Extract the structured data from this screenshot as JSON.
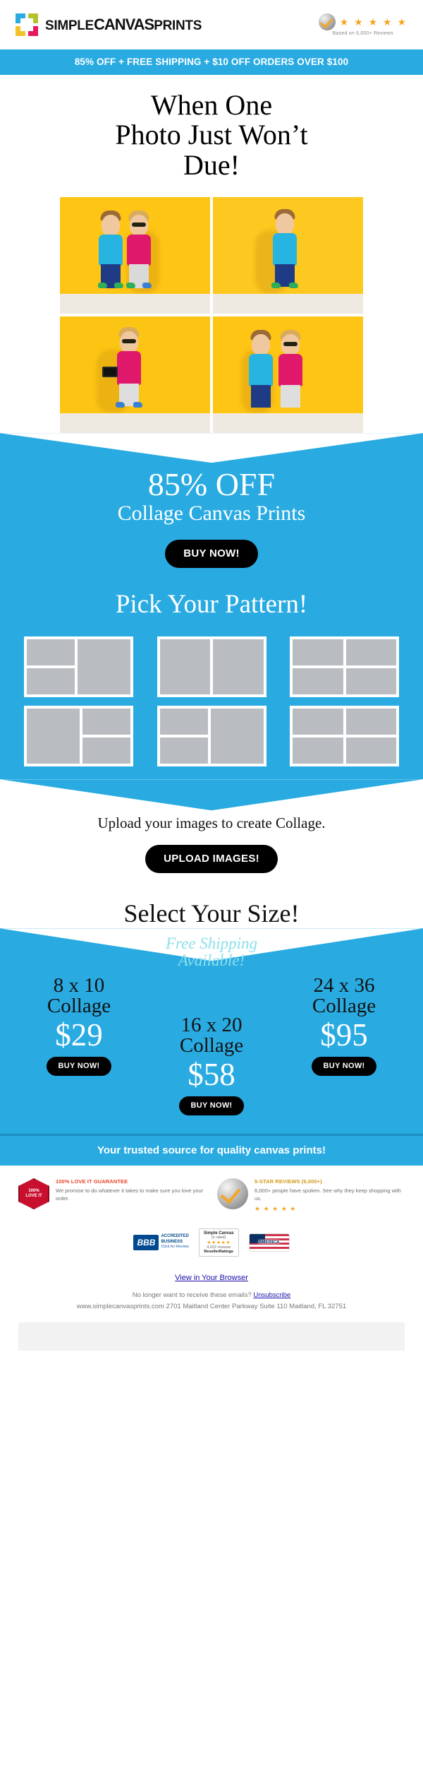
{
  "brand": {
    "name_part1": "SIMPLE",
    "name_part2": "CANVAS",
    "name_part3": "PRINTS",
    "logo_icon": "four-square-logo-icon",
    "colors": {
      "primary_blue": "#29abe2",
      "accent_yellow": "#fec515",
      "black": "#000000",
      "star_gold": "#f5a623"
    }
  },
  "header": {
    "review_badge": {
      "icon": "check-seal-icon",
      "stars": "★ ★ ★ ★ ★",
      "caption": "Based on 6,000+ Reviews"
    }
  },
  "promo_bar": {
    "text": "85% OFF + FREE SHIPPING + $10 OFF ORDERS OVER $100"
  },
  "hero": {
    "title_line1": "When One",
    "title_line2": "Photo Just Won’t",
    "title_line3": "Due!",
    "collage_alt": "four-photo-collage-of-kids"
  },
  "offer": {
    "headline": "85% OFF",
    "subhead": "Collage Canvas Prints",
    "cta": "BUY NOW!"
  },
  "pattern_section": {
    "title": "Pick Your Pattern!",
    "patterns": [
      {
        "name": "pattern-1-left-split-right-tall"
      },
      {
        "name": "pattern-2-two-tall-columns"
      },
      {
        "name": "pattern-3-quad-grid"
      },
      {
        "name": "pattern-4-left-tall-right-split"
      },
      {
        "name": "pattern-5-left-split-right-tall"
      },
      {
        "name": "pattern-6-quad-grid-wide"
      }
    ]
  },
  "upload_section": {
    "text": "Upload your images to create Collage.",
    "cta": "UPLOAD IMAGES!"
  },
  "size_section": {
    "title": "Select Your Size!",
    "free_shipping_line1": "Free Shipping",
    "free_shipping_line2": "Available!",
    "options": [
      {
        "size": "8 x 10",
        "product": "Collage",
        "price": "$29",
        "cta": "BUY NOW!"
      },
      {
        "size": "16 x 20",
        "product": "Collage",
        "price": "$58",
        "cta": "BUY NOW!"
      },
      {
        "size": "24 x 36",
        "product": "Collage",
        "price": "$95",
        "cta": "BUY NOW!"
      }
    ]
  },
  "trust_bar": {
    "text": "Your trusted source for quality canvas prints!"
  },
  "footer": {
    "guarantee": {
      "seal_icon": "love-it-guarantee-seal-icon",
      "seal_line1": "100%",
      "seal_line2": "LOVE IT",
      "title": "100% LOVE IT GUARANTEE",
      "body": "We promise to do whatever it takes to make sure you love your order."
    },
    "reviews": {
      "seal_icon": "check-seal-icon",
      "title": "5-STAR REVIEWS (6,000+)",
      "body": "6,000+ people have spoken. See why they keep shopping with us.",
      "stars": "★ ★ ★ ★ ★"
    },
    "badges": {
      "bbb_mark": "BBB",
      "bbb_line1": "ACCREDITED",
      "bbb_line2": "BUSINESS",
      "bbb_click": "Click for Review",
      "reseller_title": "Simple Canvas",
      "reseller_rated": "(x rated)",
      "reseller_stars": "★★★★★",
      "reseller_count": "4,022 reviews",
      "reseller_brand": "ResellerRatings",
      "america_label": "AMERICA"
    },
    "view_browser": "View in Your Browser",
    "unsub_prefix": "No longer want to receive these emails? ",
    "unsub_link": "Unsubscribe",
    "address": "www.simplecanvasprints.com 2701 Maitland Center Parkway Suite 110 Maitland, FL 32751"
  }
}
